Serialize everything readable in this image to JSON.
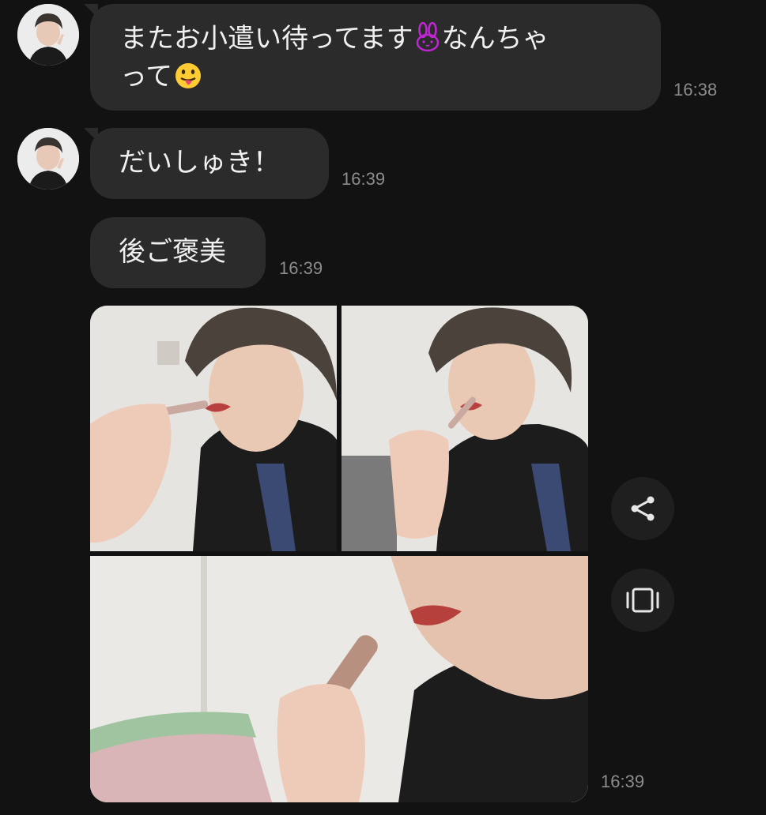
{
  "messages": [
    {
      "text_line1": "またお小遣い待ってます",
      "text_line1_end": "なんちゃ",
      "text_line2": "って",
      "time": "16:38"
    },
    {
      "text": "だいしゅき！",
      "time": "16:39"
    },
    {
      "text": "後ご褒美",
      "time": "16:39"
    }
  ],
  "photo_message": {
    "time": "16:39",
    "photo_count": 3
  },
  "actions": {
    "share_icon": "share-icon",
    "gallery_icon": "gallery-icon"
  },
  "colors": {
    "background": "#121212",
    "bubble": "#2b2b2b",
    "timestamp": "#8c8c8c",
    "rabbit_emoji": "#c026d3"
  }
}
